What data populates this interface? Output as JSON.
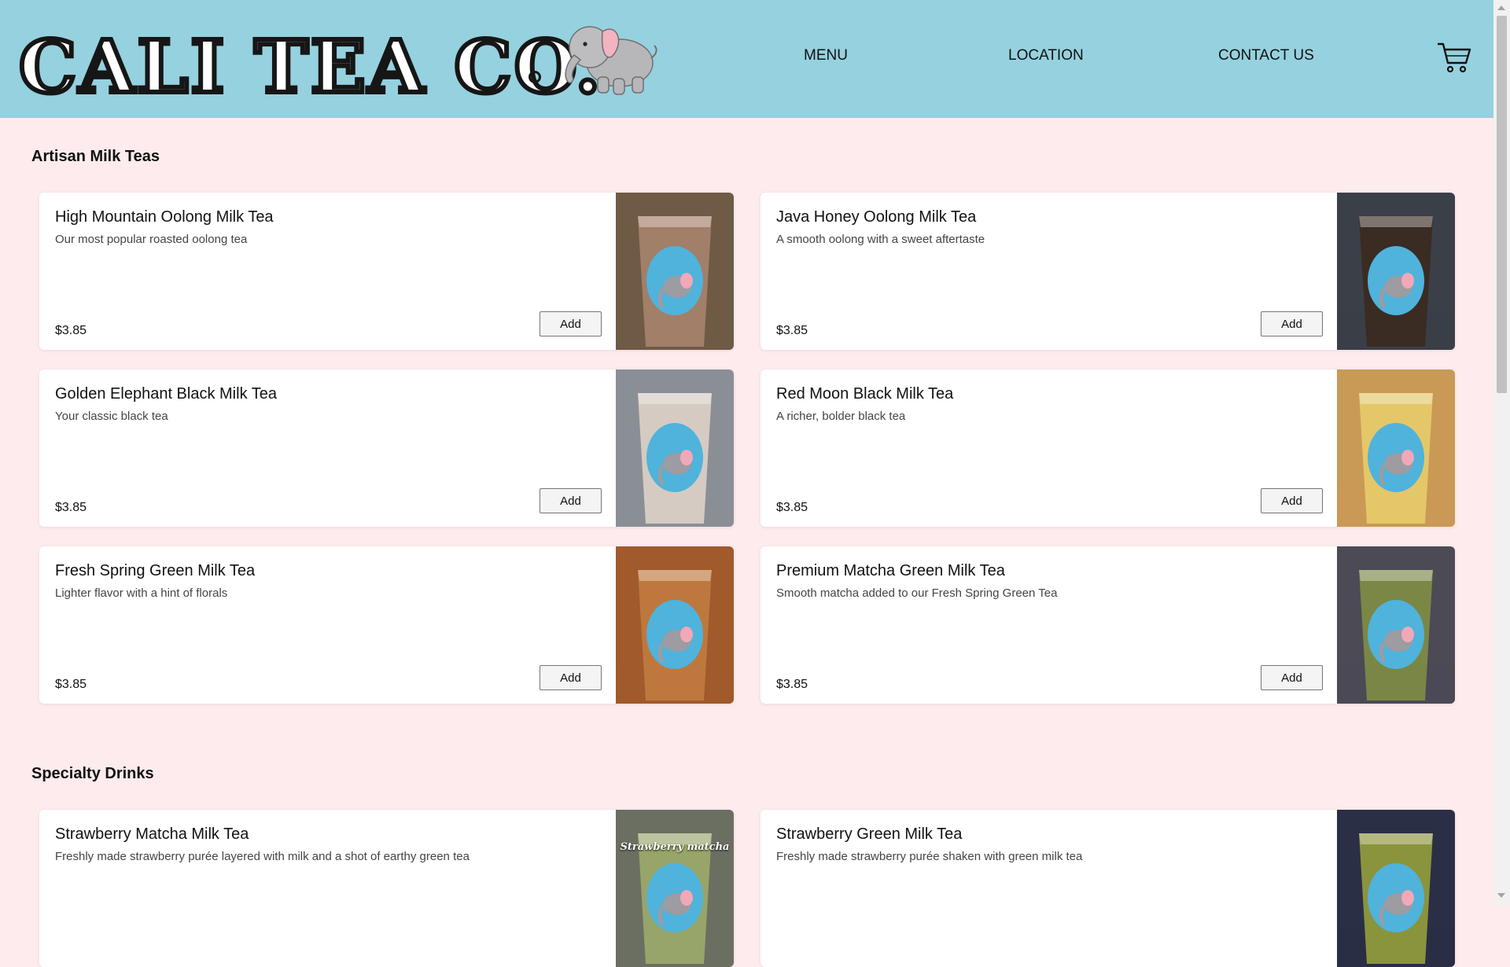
{
  "header": {
    "logo_text": "CALI TEA CO.",
    "nav": [
      "MENU",
      "LOCATION",
      "CONTACT US"
    ],
    "colors": {
      "background": "#96d1df",
      "page": "#fdebed"
    }
  },
  "sections": [
    {
      "title": "Artisan Milk Teas",
      "items": [
        {
          "name": "High Mountain Oolong Milk Tea",
          "desc": "Our most popular roasted oolong tea",
          "price": "$3.85",
          "button": "Add"
        },
        {
          "name": "Java Honey Oolong Milk Tea",
          "desc": "A smooth oolong with a sweet aftertaste",
          "price": "$3.85",
          "button": "Add"
        },
        {
          "name": "Golden Elephant Black Milk Tea",
          "desc": "Your classic black tea",
          "price": "$3.85",
          "button": "Add"
        },
        {
          "name": "Red Moon Black Milk Tea",
          "desc": "A richer, bolder black tea",
          "price": "$3.85",
          "button": "Add"
        },
        {
          "name": "Fresh Spring Green Milk Tea",
          "desc": "Lighter flavor with a hint of florals",
          "price": "$3.85",
          "button": "Add"
        },
        {
          "name": "Premium Matcha Green Milk Tea",
          "desc": "Smooth matcha added to our Fresh Spring Green Tea",
          "price": "$3.85",
          "button": "Add"
        }
      ]
    },
    {
      "title": "Specialty Drinks",
      "items": [
        {
          "name": "Strawberry Matcha Milk Tea",
          "desc": "Freshly made strawberry purée layered with milk and a shot of earthy green tea",
          "photo_caption": "Strawberry matcha"
        },
        {
          "name": "Strawberry Green Milk Tea",
          "desc": "Freshly made strawberry purée shaken with green milk tea"
        }
      ]
    }
  ],
  "drink_colors": [
    "#a3826a",
    "#3a2a22",
    "#d9cfc4",
    "#e6c96a",
    "#c07a3e",
    "#7c8a45",
    "#9aa86a",
    "#8f9a3c"
  ]
}
